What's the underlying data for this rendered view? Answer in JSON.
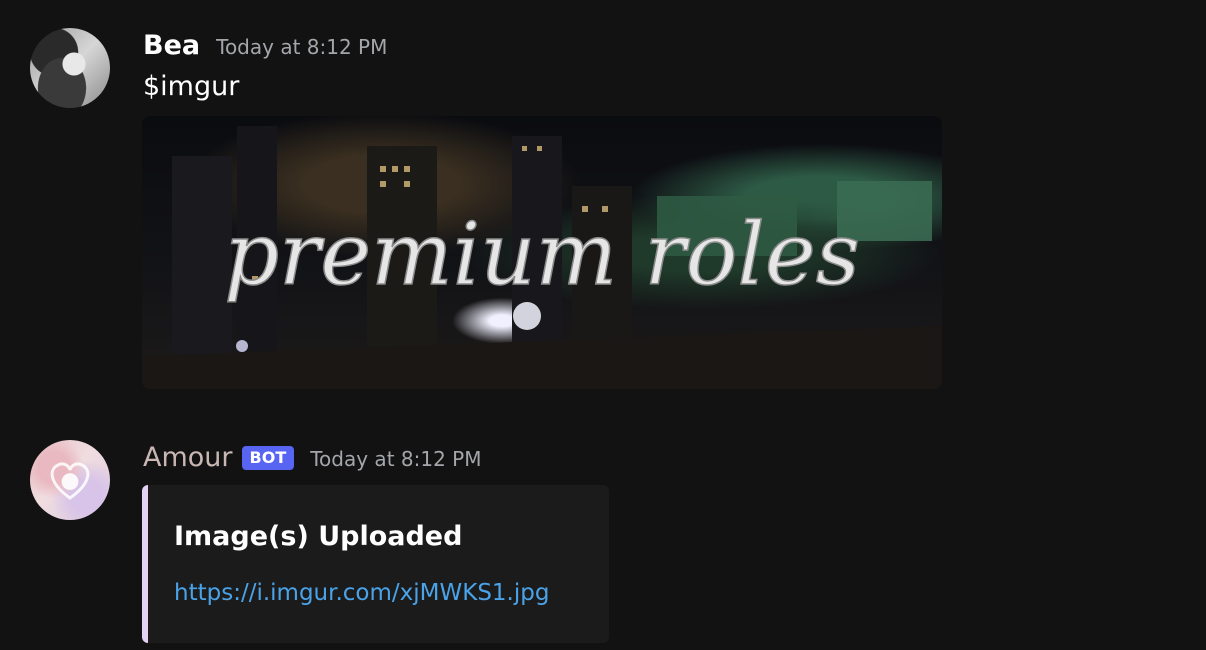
{
  "messages": [
    {
      "author": "Bea",
      "timestamp": "Today at 8:12 PM",
      "content": "$imgur",
      "attachment": {
        "overlay_text": "premium roles"
      }
    },
    {
      "author": "Amour",
      "badge": "BOT",
      "timestamp": "Today at 8:12 PM",
      "embed": {
        "title": "Image(s) Uploaded",
        "link": "https://i.imgur.com/xjMWKS1.jpg",
        "accent_color": "#e3d2f2"
      }
    }
  ],
  "colors": {
    "background": "#121212",
    "link": "#4aa3e8",
    "bot_badge": "#5865f2",
    "timestamp": "#a3a6aa"
  }
}
